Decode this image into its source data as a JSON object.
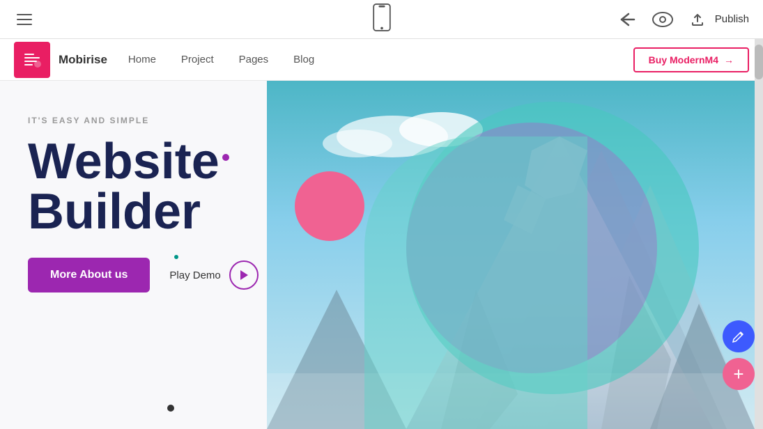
{
  "toolbar": {
    "hamburger_label": "Menu",
    "phone_icon": "phone-icon",
    "back_icon": "back-icon",
    "eye_icon": "eye-icon",
    "publish_label": "Publish"
  },
  "navbar": {
    "brand": "Mobirise",
    "links": [
      "Home",
      "Project",
      "Pages",
      "Blog"
    ],
    "buy_label": "Buy ModernM4",
    "buy_arrow": "→"
  },
  "hero": {
    "subtitle": "IT'S EASY AND SIMPLE",
    "title_line1": "Website",
    "title_line2": "Builder",
    "cta_label": "More About us",
    "play_label": "Play Demo"
  },
  "fab": {
    "edit_icon": "pencil",
    "add_icon": "+"
  }
}
